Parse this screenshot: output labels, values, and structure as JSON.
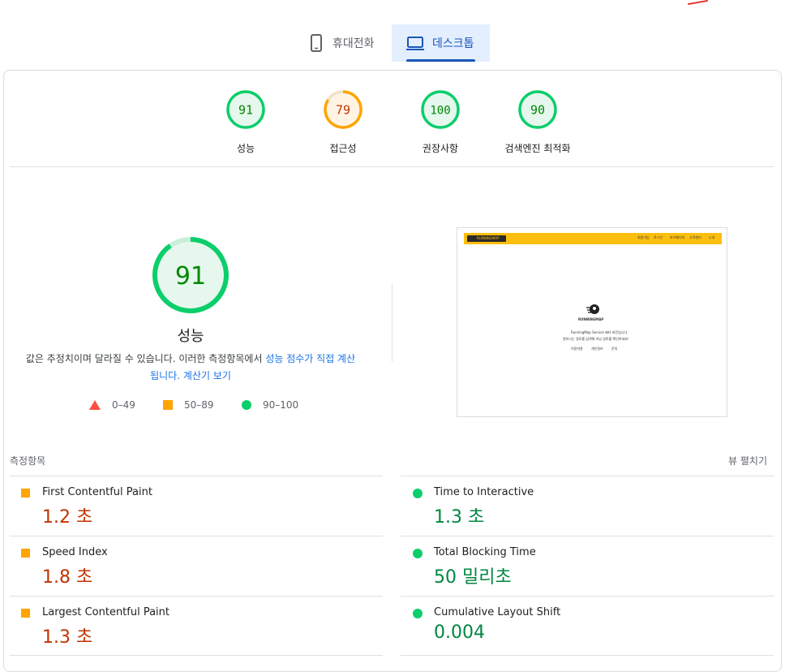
{
  "device_tabs": [
    {
      "label": "휴대전화",
      "icon": "smartphone-icon",
      "selected": false
    },
    {
      "label": "데스크톱",
      "icon": "laptop-icon",
      "selected": true
    }
  ],
  "categories": [
    {
      "name": "성능",
      "score": 91,
      "status": "good",
      "color": "#0cce6b"
    },
    {
      "name": "접근성",
      "score": 79,
      "status": "average",
      "color": "#ffa400"
    },
    {
      "name": "권장사항",
      "score": 100,
      "status": "good",
      "color": "#0cce6b"
    },
    {
      "name": "검색엔진 최적화",
      "score": 90,
      "status": "good",
      "color": "#0cce6b"
    }
  ],
  "performance": {
    "score": 91,
    "title": "성능",
    "description_prefix": "값은 추정치이며 달라질 수 있습니다. 이러한 측정항목에서 ",
    "description_link": "성능 점수가 직접 계산됩니다.",
    "calculator_link": "계산기 보기",
    "legend": [
      {
        "range": "0–49",
        "shape": "triangle",
        "color": "#ff4e42"
      },
      {
        "range": "50–89",
        "shape": "square",
        "color": "#ffa400"
      },
      {
        "range": "90–100",
        "shape": "circle",
        "color": "#0cce6b"
      }
    ]
  },
  "thumbnail": {
    "brand": "RUNNINGMAP",
    "nav": [
      "회원가입",
      "로그인",
      "마이페이지",
      "고객센터",
      "소개"
    ],
    "center_brand": "RUNNINGMAP",
    "lines": [
      "RunningMap Service 베타 버전입니다.",
      "원하시는 경로를 검색해 러닝 경로를 확인하세요!",
      "이용약관",
      "개인정보",
      "문의"
    ]
  },
  "metrics": {
    "header": "측정항목",
    "expand_label": "뷰 펼치기",
    "items": [
      {
        "name": "First Contentful Paint",
        "value": "1.2 초",
        "status": "average"
      },
      {
        "name": "Time to Interactive",
        "value": "1.3 초",
        "status": "good"
      },
      {
        "name": "Speed Index",
        "value": "1.8 초",
        "status": "average"
      },
      {
        "name": "Total Blocking Time",
        "value": "50 밀리초",
        "status": "good"
      },
      {
        "name": "Largest Contentful Paint",
        "value": "1.3 초",
        "status": "average"
      },
      {
        "name": "Cumulative Layout Shift",
        "value": "0.004",
        "status": "good"
      }
    ]
  },
  "colors": {
    "good": "#0cce6b",
    "average": "#ffa400",
    "fail": "#ff4e42",
    "accent": "#1a73e8"
  }
}
